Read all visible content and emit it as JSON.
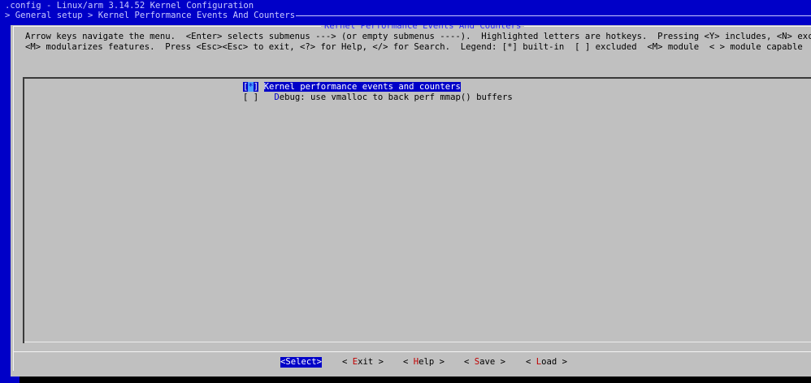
{
  "window": {
    "title": ".config - Linux/arm 3.14.52 Kernel Configuration",
    "breadcrumb": "> General setup > Kernel Performance Events And Counters"
  },
  "dialog": {
    "title": "Kernel Performance Events And Counters",
    "help_line_1": "Arrow keys navigate the menu.  <Enter> selects submenus ---> (or empty submenus ----).  Highlighted letters are hotkeys.  Pressing <Y> includes, <N> exclu",
    "help_line_2": "<M> modularizes features.  Press <Esc><Esc> to exit, <?> for Help, </> for Search.  Legend: [*] built-in  [ ] excluded  <M> module  < > module capable"
  },
  "menu": {
    "items": [
      {
        "bracket_open": "[",
        "state": "*",
        "bracket_close": "]",
        "label": "Kernel performance events and counters",
        "selected": true
      },
      {
        "bracket_open": "[",
        "state": " ",
        "bracket_close": "]",
        "hotkey": "D",
        "label_rest": "ebug: use vmalloc to back perf mmap() buffers",
        "selected": false
      }
    ]
  },
  "buttons": [
    {
      "open": "<",
      "hotkey": "S",
      "rest": "elect",
      "close": ">"
    },
    {
      "open": "< ",
      "hotkey": "E",
      "rest": "xit",
      "close": " >"
    },
    {
      "open": "< ",
      "hotkey": "H",
      "rest": "elp",
      "close": " >"
    },
    {
      "open": "< ",
      "hotkey": "S",
      "rest": "ave",
      "close": " >"
    },
    {
      "open": "< ",
      "hotkey": "L",
      "rest": "oad",
      "close": " >"
    }
  ],
  "colors": {
    "background": "#0000c8",
    "dialog": "#c0c0c0",
    "highlight": "#0000c8",
    "hotkey": "#c00000",
    "title": "#2a2aff"
  }
}
